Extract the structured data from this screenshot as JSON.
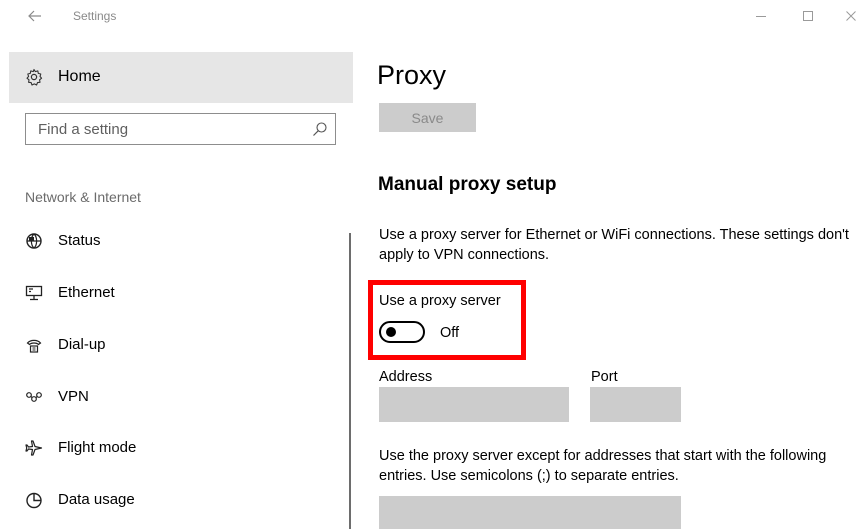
{
  "window": {
    "title": "Settings",
    "icons": {
      "back": "back-arrow-icon",
      "minimize": "minimize-icon",
      "maximize": "maximize-icon",
      "close": "close-icon"
    }
  },
  "sidebar": {
    "home": {
      "label": "Home",
      "icon": "gear-icon"
    },
    "search": {
      "placeholder": "Find a setting",
      "value": "",
      "icon": "search-icon"
    },
    "section_label": "Network & Internet",
    "items": [
      {
        "label": "Status",
        "icon": "globe-icon"
      },
      {
        "label": "Ethernet",
        "icon": "ethernet-icon"
      },
      {
        "label": "Dial-up",
        "icon": "dial-up-icon"
      },
      {
        "label": "VPN",
        "icon": "vpn-icon"
      },
      {
        "label": "Flight mode",
        "icon": "airplane-icon"
      },
      {
        "label": "Data usage",
        "icon": "data-usage-icon"
      }
    ]
  },
  "main": {
    "title": "Proxy",
    "save_label": "Save",
    "manual_heading": "Manual proxy setup",
    "manual_description": "Use a proxy server for Ethernet or WiFi connections. These settings don't apply to VPN connections.",
    "use_proxy": {
      "label": "Use a proxy server",
      "state": "Off",
      "enabled": false
    },
    "address": {
      "label": "Address",
      "value": ""
    },
    "port": {
      "label": "Port",
      "value": ""
    },
    "exceptions_description": "Use the proxy server except for addresses that start with the following entries. Use semicolons (;) to separate entries.",
    "exceptions": {
      "value": ""
    }
  },
  "colors": {
    "highlight": "#ff0000",
    "selected_background": "#e6e6e6",
    "disabled_button": "#cccccc",
    "field_background": "#cccccc"
  }
}
